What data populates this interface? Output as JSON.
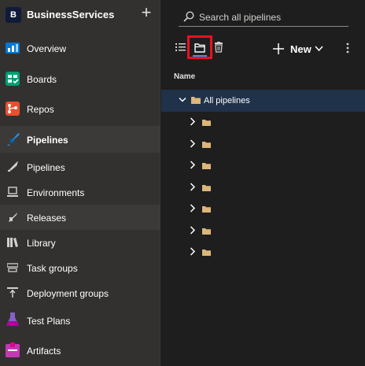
{
  "project": {
    "avatar_letter": "B",
    "name": "BusinessServices"
  },
  "nav": {
    "overview": "Overview",
    "boards": "Boards",
    "repos": "Repos",
    "pipelines_section": "Pipelines",
    "pipelines": "Pipelines",
    "environments": "Environments",
    "releases": "Releases",
    "library": "Library",
    "task_groups": "Task groups",
    "deployment_groups": "Deployment groups",
    "test_plans": "Test Plans",
    "artifacts": "Artifacts"
  },
  "search": {
    "placeholder": "Search all pipelines"
  },
  "toolbar": {
    "new_label": "New"
  },
  "table": {
    "column_name": "Name",
    "root_label": "All pipelines",
    "folder_count": 7
  },
  "colors": {
    "sidebar_bg": "#323130",
    "main_bg": "#1e1e1e",
    "selected_row": "#20314a",
    "highlight": "#e81123",
    "folder": "#dcb67a"
  },
  "icons": {
    "overview": "overview-icon",
    "boards": "boards-icon",
    "repos": "repos-icon",
    "pipelines_section": "pipelines-rocket-icon",
    "pipelines": "pipelines-icon",
    "environments": "environments-icon",
    "releases": "releases-rocket-icon",
    "library": "library-icon",
    "task_groups": "task-groups-icon",
    "deployment_groups": "deployment-groups-icon",
    "test_plans": "test-plans-flask-icon",
    "artifacts": "artifacts-icon"
  }
}
